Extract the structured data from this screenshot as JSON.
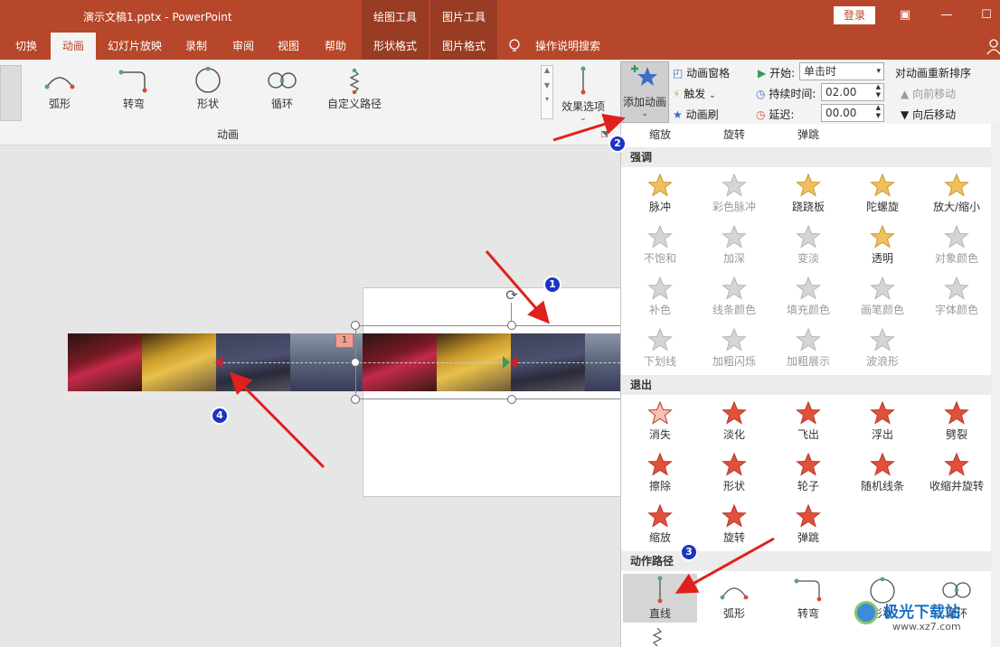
{
  "titlebar": {
    "doc_title": "演示文稿1.pptx  -  PowerPoint",
    "ctx_draw_tools": "绘图工具",
    "ctx_picture_tools": "图片工具",
    "login": "登录"
  },
  "tabs": {
    "switch": "切换",
    "animation": "动画",
    "slideshow": "幻灯片放映",
    "record": "录制",
    "review": "审阅",
    "view": "视图",
    "help": "帮助",
    "shape_format": "形状格式",
    "picture_format": "图片格式",
    "tell_me": "操作说明搜索"
  },
  "ribbon": {
    "gallery": [
      "弧形",
      "转弯",
      "形状",
      "循环",
      "自定义路径"
    ],
    "group_label": "动画",
    "effect_options": "效果选项",
    "add_animation": "添加动画",
    "anim_pane": "动画窗格",
    "trigger": "触发",
    "anim_painter": "动画刷",
    "start_label": "开始:",
    "start_value": "单击时",
    "duration_label": "持续时间:",
    "duration_value": "02.00",
    "delay_label": "延迟:",
    "delay_value": "00.00",
    "reorder_title": "对动画重新排序",
    "move_earlier": "向前移动",
    "move_later": "向后移动"
  },
  "slide": {
    "anim_tag": "1"
  },
  "panel": {
    "top_row": [
      "缩放",
      "旋转",
      "弹跳"
    ],
    "emphasis_header": "强调",
    "emphasis": [
      "脉冲",
      "彩色脉冲",
      "跷跷板",
      "陀螺旋",
      "放大/缩小",
      "不饱和",
      "加深",
      "变淡",
      "透明",
      "对象颜色",
      "补色",
      "线条颜色",
      "填充颜色",
      "画笔颜色",
      "字体颜色",
      "下划线",
      "加粗闪烁",
      "加粗展示",
      "波浪形"
    ],
    "exit_header": "退出",
    "exit": [
      "消失",
      "淡化",
      "飞出",
      "浮出",
      "劈裂",
      "擦除",
      "形状",
      "轮子",
      "随机线条",
      "收缩并旋转",
      "缩放",
      "旋转",
      "弹跳"
    ],
    "path_header": "动作路径",
    "paths": [
      "直线",
      "弧形",
      "转弯",
      "形状",
      "循环"
    ]
  },
  "annotations": [
    "1",
    "2",
    "3",
    "4"
  ],
  "watermark": {
    "name": "极光下载站",
    "url": "www.xz7.com"
  },
  "colors": {
    "brand": "#b7472a",
    "context_tab": "#983c23",
    "badge": "#1c34c4",
    "arrow": "#e0201c"
  }
}
